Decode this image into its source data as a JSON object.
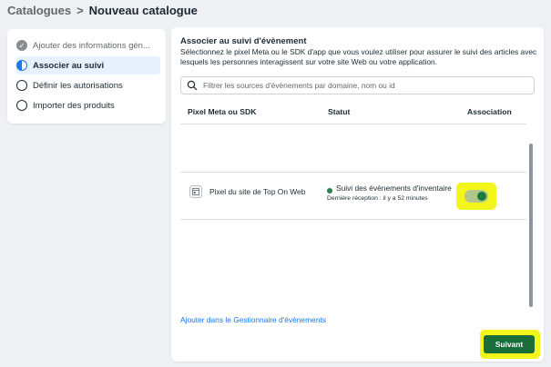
{
  "breadcrumb": {
    "parent": "Catalogues",
    "separator": ">",
    "current": "Nouveau catalogue"
  },
  "steps": [
    {
      "label": "Ajouter des informations gén...",
      "state": "done"
    },
    {
      "label": "Associer au suivi",
      "state": "active"
    },
    {
      "label": "Définir les autorisations",
      "state": "todo"
    },
    {
      "label": "Importer des produits",
      "state": "todo"
    }
  ],
  "section": {
    "title": "Associer au suivi d'évènement",
    "description": "Sélectionnez le pixel Meta ou le SDK d'app que vous voulez utiliser pour assurer le suivi des articles avec lesquels les personnes interagissent sur votre site Web ou votre application."
  },
  "search": {
    "placeholder": "Filtrer les sources d'évènements par domaine, nom ou id",
    "value": ""
  },
  "table": {
    "columns": {
      "source": "Pixel Meta ou SDK",
      "status": "Statut",
      "association": "Association"
    },
    "rows": [
      {
        "source": "Pixel du site de Top On Web",
        "status": "Suivi des évènements d'inventaire",
        "last_received": "Dernière réception : il y a 52 minutes",
        "associated": true
      }
    ]
  },
  "link_label": "Ajouter dans le Gestionnaire d'évènements",
  "next_button_label": "Suivant",
  "colors": {
    "primary": "#1877f2",
    "success": "#1a6e3a",
    "highlight": "#f4f51a"
  }
}
